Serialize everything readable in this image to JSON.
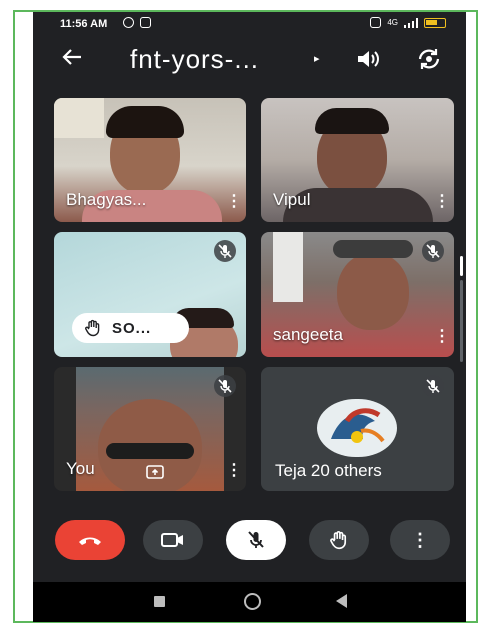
{
  "status_bar": {
    "time": "11:56 AM",
    "signal_label": "4G"
  },
  "header": {
    "meeting_title": "fnt-yors-...",
    "caret": "▸"
  },
  "participants": [
    {
      "name": "Bhagyas...",
      "muted": false
    },
    {
      "name": "Vipul",
      "muted": false
    },
    {
      "name": "SO...",
      "muted": true,
      "hand_raised": true
    },
    {
      "name": "sangeeta",
      "muted": true
    },
    {
      "name": "You",
      "muted": true
    },
    {
      "name": "Teja",
      "others_label": "20 others",
      "muted": true
    }
  ],
  "controls": {
    "more_label": "⋮"
  },
  "colors": {
    "background": "#202124",
    "tile": "#3c4043",
    "end_call": "#ea4335",
    "frame_border": "#5cb85c",
    "battery": "#f0c020"
  },
  "icons": [
    "back-arrow-icon",
    "speaker-icon",
    "camera-switch-icon",
    "mic-off-icon",
    "raise-hand-icon",
    "end-call-icon",
    "video-icon",
    "more-vert-icon",
    "present-icon"
  ]
}
